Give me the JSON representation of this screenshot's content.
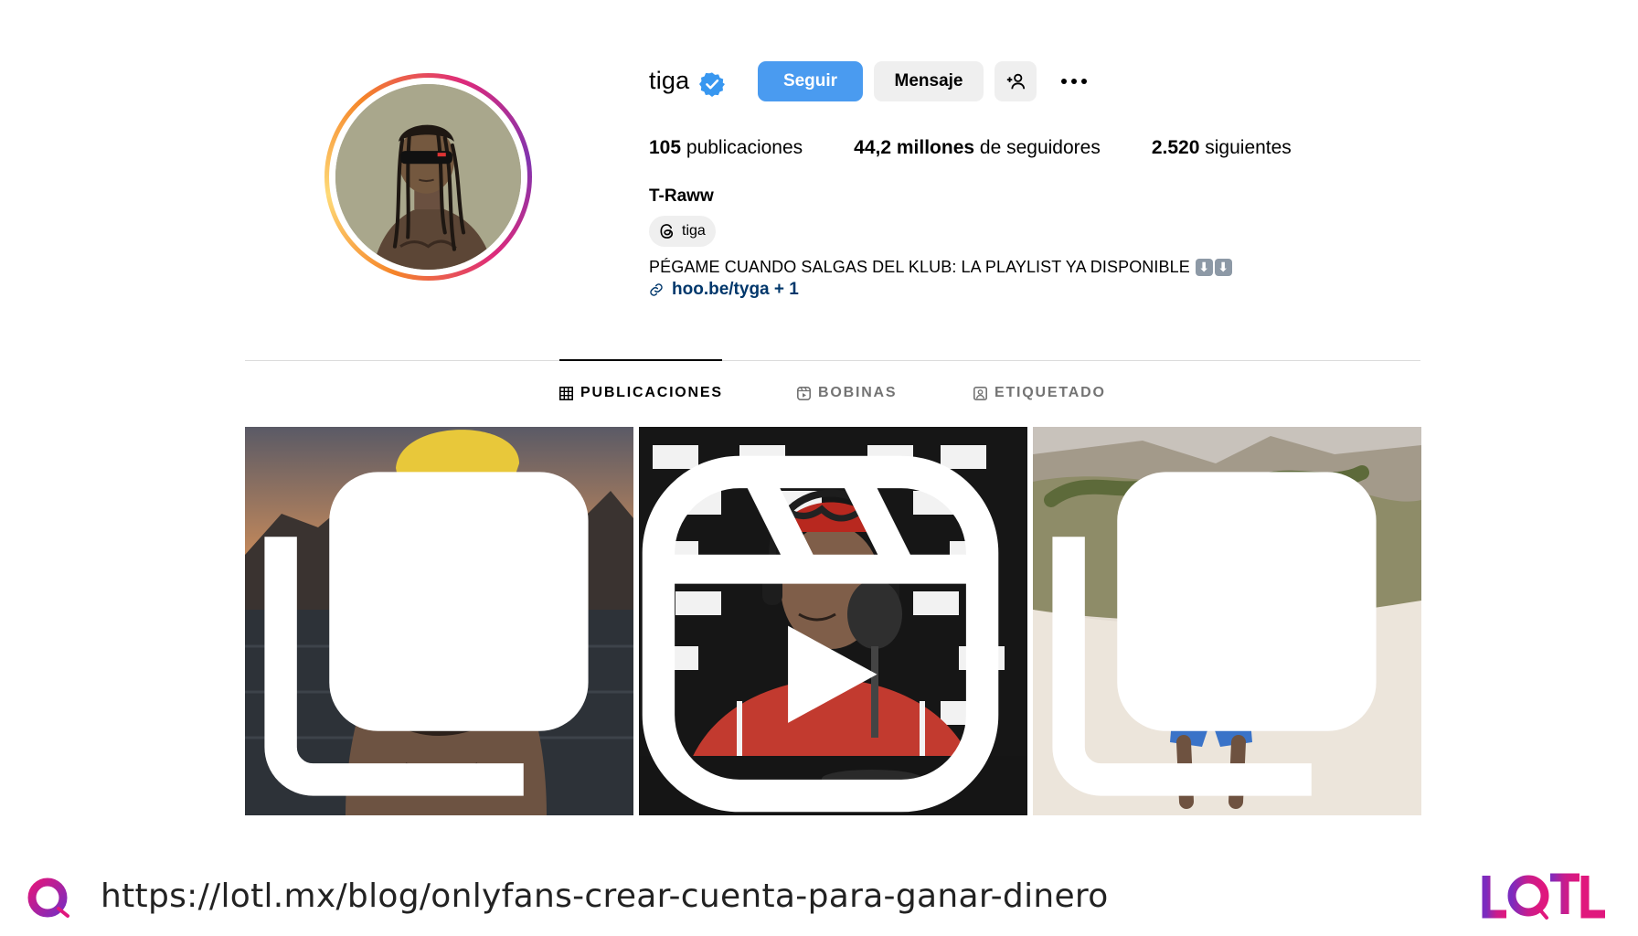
{
  "profile": {
    "username": "tiga",
    "verified": true,
    "display_name": "T-Raww",
    "threads_label": "tiga",
    "bio": "PÉGAME CUANDO SALGAS DEL KLUB: LA PLAYLIST YA DISPONIBLE",
    "bio_emoji": [
      "⬇",
      "⬇"
    ],
    "link": "hoo.be/tyga + 1"
  },
  "actions": {
    "follow": "Seguir",
    "message": "Mensaje",
    "suggest_icon": "add-person-icon",
    "more_icon": "more-dots-icon"
  },
  "stats": [
    {
      "value": "105",
      "label": "publicaciones"
    },
    {
      "value": "44,2 millones",
      "label": "de seguidores"
    },
    {
      "value": "2.520",
      "label": "siguientes"
    }
  ],
  "tabs": [
    {
      "label": "PUBLICACIONES",
      "icon": "grid-icon",
      "active": true
    },
    {
      "label": "BOBINAS",
      "icon": "reels-icon",
      "active": false
    },
    {
      "label": "ETIQUETADO",
      "icon": "tagged-icon",
      "active": false
    }
  ],
  "posts": [
    {
      "type": "carousel",
      "badge_icon": "carousel-icon"
    },
    {
      "type": "reel",
      "badge_icon": "reel-icon"
    },
    {
      "type": "carousel",
      "badge_icon": "carousel-icon"
    }
  ],
  "footer": {
    "url": "https://lotl.mx/blog/onlyfans-crear-cuenta-para-ganar-dinero",
    "brand": "LOTL"
  },
  "colors": {
    "follow_button": "#4a9bf0",
    "link": "#00376b",
    "verified": "#3897f0",
    "brand_pink": "#e0177d",
    "brand_purple": "#7b2cbf"
  }
}
